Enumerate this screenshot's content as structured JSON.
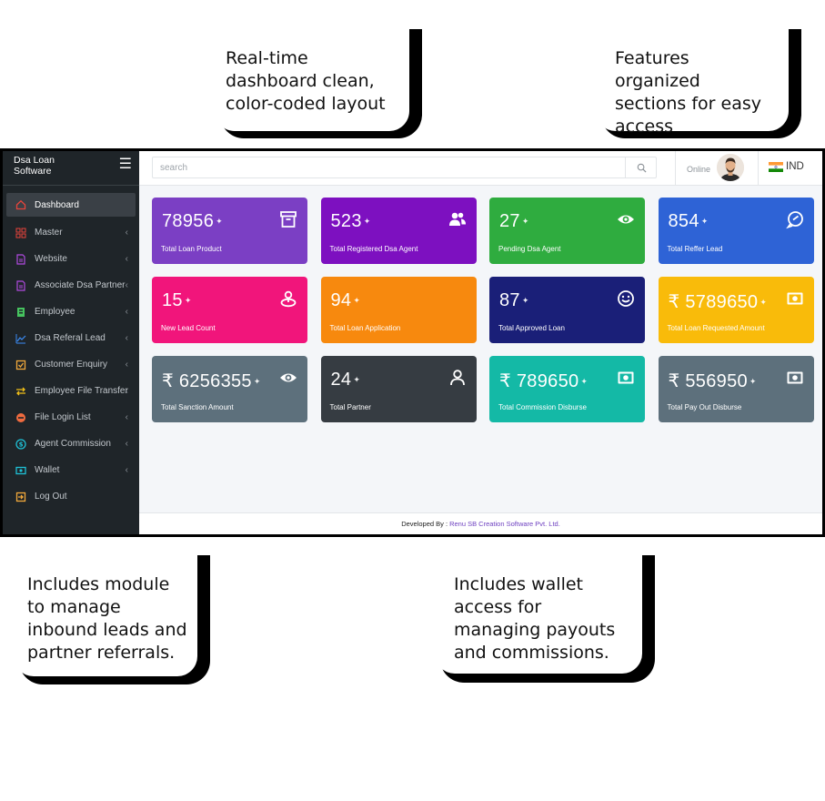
{
  "callouts": {
    "top_left": "Real-time dashboard clean, color-coded layout",
    "top_right": "Features organized sections for easy access",
    "bottom_left": "Includes module to manage inbound leads and partner referrals.",
    "bottom_right": "Includes wallet access for managing payouts and commissions."
  },
  "brand": {
    "line1": "Dsa Loan",
    "line2": "Software",
    "icon": "hamburger-icon"
  },
  "sidebar": {
    "items": [
      {
        "label": "Dashboard",
        "icon": "home-icon",
        "color": "#e8443b"
      },
      {
        "label": "Master",
        "icon": "grid-icon",
        "color": "#e8443b"
      },
      {
        "label": "Website",
        "icon": "document-icon",
        "color": "#b04ae0"
      },
      {
        "label": "Associate Dsa Partner",
        "icon": "document-icon",
        "color": "#b04ae0"
      },
      {
        "label": "Employee",
        "icon": "badge-icon",
        "color": "#46c35f"
      },
      {
        "label": "Dsa Referal Lead",
        "icon": "chart-line-icon",
        "color": "#3b8cf5"
      },
      {
        "label": "Customer Enquiry",
        "icon": "checkbox-icon",
        "color": "#f2a93b"
      },
      {
        "label": "Employee File Transfer",
        "icon": "transfer-icon",
        "color": "#f2c018"
      },
      {
        "label": "File Login List",
        "icon": "circle-minus-icon",
        "color": "#ef6b3f"
      },
      {
        "label": "Agent Commission",
        "icon": "dollar-circle-icon",
        "color": "#1fc1d6"
      },
      {
        "label": "Wallet",
        "icon": "money-icon",
        "color": "#1fc1d6"
      },
      {
        "label": "Log Out",
        "icon": "logout-icon",
        "color": "#f2a93b"
      }
    ]
  },
  "header": {
    "search_placeholder": "search",
    "status": "Online",
    "language": "IND"
  },
  "cards": [
    {
      "value": "78956",
      "label": "Total Loan Product",
      "icon": "archive-icon",
      "color": "#7b3fc4"
    },
    {
      "value": "523",
      "label": "Total Registered Dsa Agent",
      "icon": "users-icon",
      "color": "#7d10c0"
    },
    {
      "value": "27",
      "label": "Pending Dsa Agent",
      "icon": "eye-icon",
      "color": "#2fac3f"
    },
    {
      "value": "854",
      "label": "Total Reffer Lead",
      "icon": "chat-icon",
      "color": "#2e63d6"
    },
    {
      "value": "15",
      "label": "New Lead Count",
      "icon": "location-icon",
      "color": "#f1157b"
    },
    {
      "value": "94",
      "label": "Total Loan Application",
      "icon": "",
      "color": "#f7890e"
    },
    {
      "value": "87",
      "label": "Total Approved Loan",
      "icon": "smile-icon",
      "color": "#1a1f78"
    },
    {
      "value": "₹ 5789650",
      "label": "Total Loan Requested Amount",
      "icon": "money-icon",
      "color": "#f9bb0a"
    },
    {
      "value": "₹ 6256355",
      "label": "Total Sanction Amount",
      "icon": "eye-icon",
      "color": "#5d707c"
    },
    {
      "value": "24",
      "label": "Total Partner",
      "icon": "user-icon",
      "color": "#363c42"
    },
    {
      "value": "₹ 789650",
      "label": "Total Commission Disburse",
      "icon": "money-icon",
      "color": "#14b9a6"
    },
    {
      "value": "₹ 556950",
      "label": "Total Pay Out Disburse",
      "icon": "money-icon",
      "color": "#5d707c"
    }
  ],
  "footer": {
    "prefix": "Developed By :",
    "company": "Renu SB Creation Software Pvt. Ltd."
  }
}
